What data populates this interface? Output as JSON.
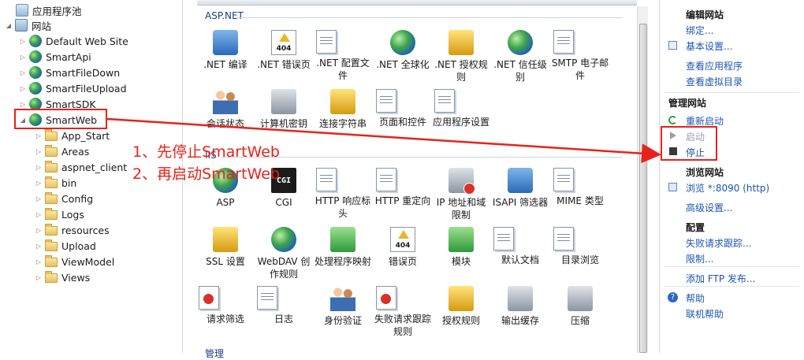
{
  "tree": {
    "app_pool": "应用程序池",
    "sites": "网站",
    "site_items": [
      "Default Web Site",
      "SmartApi",
      "SmartFileDown",
      "SmartFileUpload",
      "SmartSDK",
      "SmartWeb"
    ],
    "folders": [
      "App_Start",
      "Areas",
      "aspnet_client",
      "bin",
      "Config",
      "Logs",
      "resources",
      "Upload",
      "ViewModel",
      "Views"
    ]
  },
  "center": {
    "section_aspnet": "ASP.NET",
    "section_iis": "IIS",
    "section_mgmt": "管理",
    "aspnet_row1": [
      ".NET 编译",
      ".NET 错误页",
      ".NET 配置文件",
      ".NET 全球化",
      ".NET 授权规则",
      ".NET 信任级别",
      "SMTP 电子邮件"
    ],
    "aspnet_row2": [
      "会话状态",
      "计算机密钥",
      "连接字符串",
      "页面和控件",
      "应用程序设置"
    ],
    "iis_row1": [
      "ASP",
      "CGI",
      "HTTP 响应标头",
      "HTTP 重定向",
      "IP 地址和域限制",
      "ISAPI 筛选器",
      "MIME 类型"
    ],
    "iis_row2": [
      "SSL 设置",
      "WebDAV 创作规则",
      "处理程序映射",
      "错误页",
      "模块",
      "默认文档",
      "目录浏览"
    ],
    "iis_row3": [
      "请求筛选",
      "日志",
      "身份验证",
      "失败请求跟踪规则",
      "授权规则",
      "输出缓存",
      "压缩"
    ]
  },
  "actions": {
    "edit_site": "编辑网站",
    "bindings": "绑定...",
    "basic_settings": "基本设置...",
    "view_apps": "查看应用程序",
    "view_vdirs": "查看虚拟目录",
    "manage_site": "管理网站",
    "restart": "重新启动",
    "start": "启动",
    "stop": "停止",
    "browse_site": "浏览网站",
    "browse_port": "浏览 *:8090 (http)",
    "advanced": "高级设置...",
    "config": "配置",
    "failed_tracing": "失败请求跟踪...",
    "limits": "限制...",
    "add_ftp": "添加 FTP 发布...",
    "help": "帮助",
    "online_help": "联机帮助"
  },
  "annotation": {
    "step1": "1、先停止SmartWeb",
    "step2": "2、再启动SmartWeb"
  },
  "colors": {
    "accent": "#1f56b0",
    "annotation": "#e8221a"
  }
}
